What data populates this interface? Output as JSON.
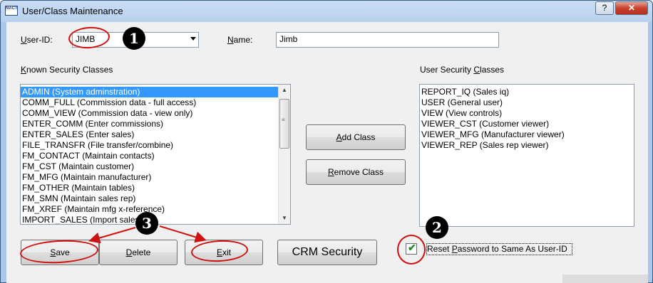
{
  "window": {
    "title": "User/Class Maintenance",
    "help_glyph": "?",
    "close_glyph": "✕",
    "app_icon_text": "NACT"
  },
  "form": {
    "userid_label_pre": "U",
    "userid_label_rest": "ser-ID:",
    "userid_value": "JIMB",
    "name_label_pre": "N",
    "name_label_rest": "ame:",
    "name_value": "Jimb"
  },
  "known": {
    "header_pre": "K",
    "header_rest": "nown Security Classes",
    "items": [
      "ADMIN (System adminstration)",
      "COMM_FULL (Commission data - full access)",
      "COMM_VIEW (Commission data - view only)",
      "ENTER_COMM (Enter commissions)",
      "ENTER_SALES (Enter sales)",
      "FILE_TRANSFR (File transfer/combine)",
      "FM_CONTACT (Maintain contacts)",
      "FM_CST (Maintain customer)",
      "FM_MFG (Maintain manufacturer)",
      "FM_OTHER (Maintain tables)",
      "FM_SMN (Maintain sales rep)",
      "FM_XREF (Maintain mfg x-reference)",
      "IMPORT_SALES (Import sales iq)"
    ],
    "selected_index": 0
  },
  "user": {
    "header_pre": "User Security ",
    "header_u": "C",
    "header_rest": "lasses",
    "items": [
      "REPORT_IQ (Sales iq)",
      "USER (General user)",
      "VIEW (View controls)",
      "VIEWER_CST (Customer viewer)",
      "VIEWER_MFG (Manufacturer viewer)",
      "VIEWER_REP (Sales rep viewer)"
    ]
  },
  "buttons": {
    "add_pre": "A",
    "add_rest": "dd Class",
    "remove_pre": "R",
    "remove_rest": "emove Class",
    "save_pre": "S",
    "save_rest": "ave",
    "delete_pre": "D",
    "delete_rest": "elete",
    "exit_pre": "E",
    "exit_rest": "xit",
    "crm": "CRM Security"
  },
  "reset": {
    "label_a": "Reset ",
    "label_u": "P",
    "label_b": "assword to Same As User-ID",
    "checked": true
  },
  "annotations": {
    "markers": [
      "1",
      "2",
      "3"
    ],
    "color": "#d01010"
  }
}
